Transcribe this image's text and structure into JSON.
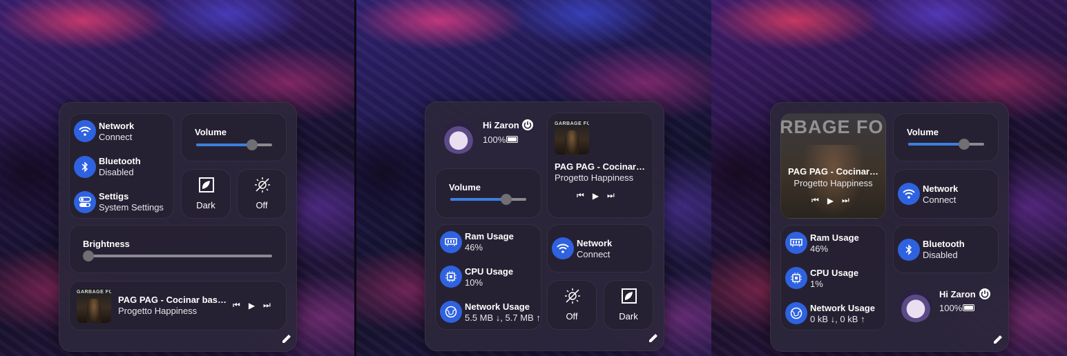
{
  "panel1": {
    "network": {
      "title": "Network",
      "sub": "Connect",
      "icon": "wifi-icon"
    },
    "bluetooth": {
      "title": "Bluetooth",
      "sub": "Disabled",
      "icon": "bluetooth-icon"
    },
    "settings": {
      "title": "Settigs",
      "sub": "System Settings",
      "icon": "toggle-icon"
    },
    "volume": {
      "label": "Volume",
      "level": 0.74
    },
    "dark": {
      "label": "Dark",
      "icon": "contrast-icon"
    },
    "off": {
      "label": "Off",
      "icon": "sun-off-icon"
    },
    "brightness": {
      "label": "Brightness",
      "level": 0.0
    },
    "player": {
      "album_text": "GARBAGE FOOD",
      "song": "PAG PAG - Cocinar bas…",
      "artist": "Progetto Happiness"
    }
  },
  "panel2": {
    "user": {
      "greeting": "Hi Zaron",
      "battery": "100%",
      "icon": "power-icon"
    },
    "player": {
      "album_text": "GARBAGE FOOD",
      "song": "PAG PAG - Cocinar…",
      "artist": "Progetto Happiness"
    },
    "volume": {
      "label": "Volume",
      "level": 0.74
    },
    "ram": {
      "title": "Ram Usage",
      "value": "46%",
      "icon": "memory-icon"
    },
    "cpu": {
      "title": "CPU Usage",
      "value": "10%",
      "icon": "cpu-icon"
    },
    "net": {
      "title": "Network Usage",
      "value": "5.5 MB ↓, 5.7 MB ↑",
      "icon": "globe-icon"
    },
    "network": {
      "title": "Network",
      "sub": "Connect",
      "icon": "wifi-icon"
    },
    "off": {
      "label": "Off",
      "icon": "sun-off-icon"
    },
    "dark": {
      "label": "Dark",
      "icon": "contrast-icon"
    }
  },
  "panel3": {
    "player": {
      "bg_text": "RBAGE FO",
      "song": "PAG PAG - Cocinar…",
      "artist": "Progetto Happiness"
    },
    "volume": {
      "label": "Volume",
      "level": 0.74
    },
    "network": {
      "title": "Network",
      "sub": "Connect",
      "icon": "wifi-icon"
    },
    "ram": {
      "title": "Ram Usage",
      "value": "46%",
      "icon": "memory-icon"
    },
    "cpu": {
      "title": "CPU Usage",
      "value": "1%",
      "icon": "cpu-icon"
    },
    "net": {
      "title": "Network Usage",
      "value": "0 kB ↓, 0 kB ↑",
      "icon": "globe-icon"
    },
    "bluetooth": {
      "title": "Bluetooth",
      "sub": "Disabled",
      "icon": "bluetooth-icon"
    },
    "user": {
      "greeting": "Hi Zaron",
      "battery": "100%",
      "icon": "power-icon"
    }
  },
  "colors": {
    "accent": "#2f62e0",
    "slider_fill": "#3c7fe0",
    "panel": "#2c263a"
  }
}
